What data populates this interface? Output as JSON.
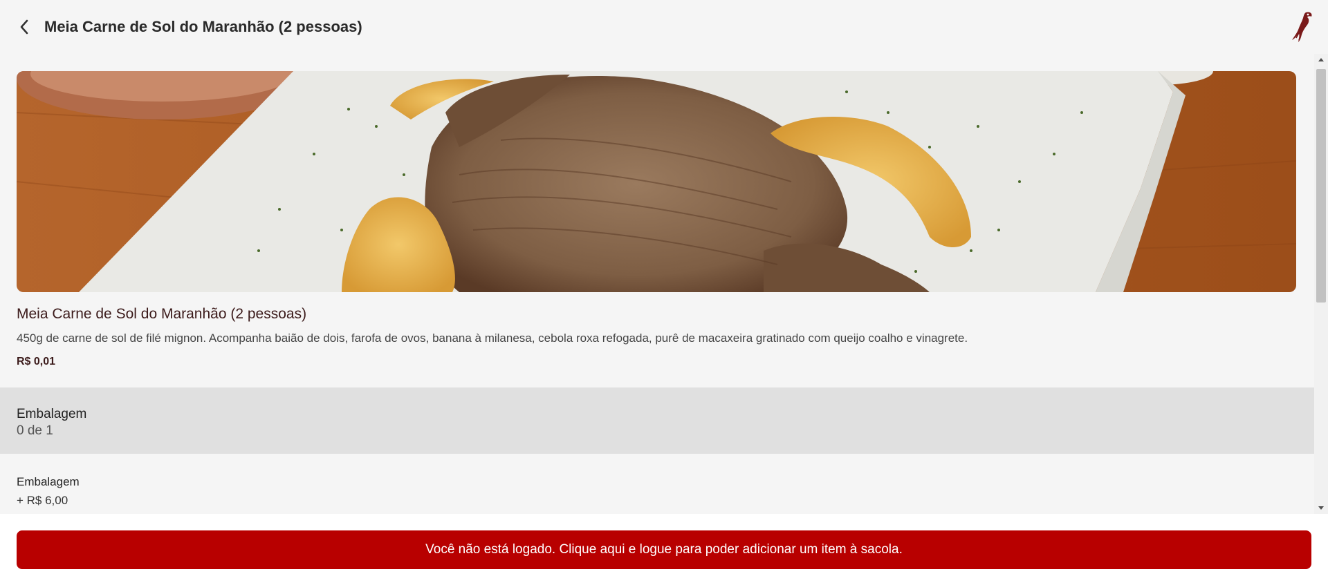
{
  "header": {
    "title": "Meia Carne de Sol do Maranhão (2 pessoas)",
    "back_icon": "chevron-left-icon",
    "logo_icon": "bird-logo"
  },
  "product": {
    "name": "Meia Carne de Sol do Maranhão (2 pessoas)",
    "description": "450g de carne de sol de filé mignon. Acompanha baião de dois, farofa de ovos, banana à milanesa, cebola roxa refogada, purê de macaxeira gratinado com queijo coalho e vinagrete.",
    "price": "R$ 0,01"
  },
  "option_group": {
    "title": "Embalagem",
    "count": "0 de 1",
    "options": [
      {
        "name": "Embalagem",
        "price": "+ R$ 6,00"
      }
    ]
  },
  "footer": {
    "login_message": "Você não está logado. Clique aqui e logue para poder adicionar um item à sacola."
  },
  "colors": {
    "accent": "#b80000",
    "background": "#f5f5f5",
    "group_header": "#e0e0e0",
    "title_text": "#3b1a1a"
  }
}
